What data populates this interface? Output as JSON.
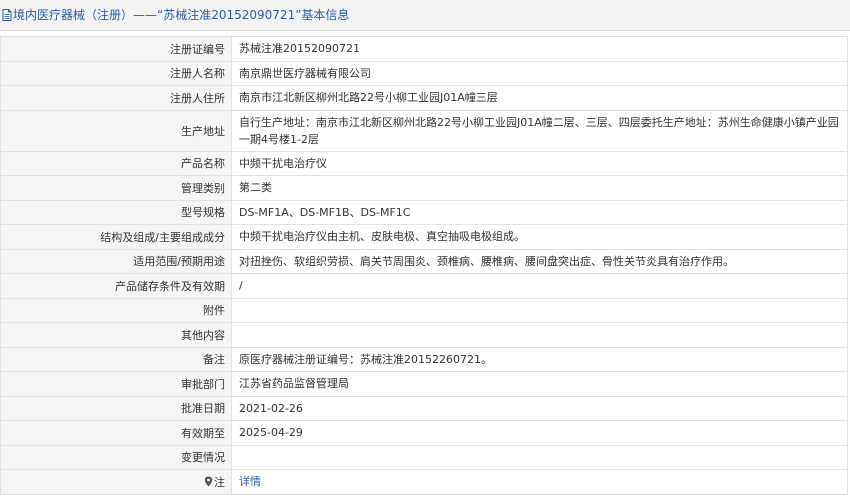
{
  "page_title": "境内医疗器械（注册）——“苏械注准20152090721”基本信息",
  "rows": [
    {
      "label": "注册证编号",
      "value": "苏械注准20152090721"
    },
    {
      "label": "注册人名称",
      "value": "南京鼎世医疗器械有限公司"
    },
    {
      "label": "注册人住所",
      "value": "南京市江北新区柳州北路22号小柳工业园J01A幢三层"
    },
    {
      "label": "生产地址",
      "value": "自行生产地址：南京市江北新区柳州北路22号小柳工业园J01A幢二层、三层、四层委托生产地址：苏州生命健康小镇产业园一期4号楼1-2层"
    },
    {
      "label": "产品名称",
      "value": "中频干扰电治疗仪"
    },
    {
      "label": "管理类别",
      "value": "第二类"
    },
    {
      "label": "型号规格",
      "value": "DS-MF1A、DS-MF1B、DS-MF1C"
    },
    {
      "label": "结构及组成/主要组成成分",
      "value": "中频干扰电治疗仪由主机、皮肤电极、真空抽吸电极组成。"
    },
    {
      "label": "适用范围/预期用途",
      "value": "对扭挫伤、软组织劳损、肩关节周围炎、颈椎病、腰椎病、腰间盘突出症、骨性关节炎具有治疗作用。"
    },
    {
      "label": "产品储存条件及有效期",
      "value": "/"
    },
    {
      "label": "附件",
      "value": ""
    },
    {
      "label": "其他内容",
      "value": ""
    },
    {
      "label": "备注",
      "value": "原医疗器械注册证编号：苏械注准20152260721。"
    },
    {
      "label": "审批部门",
      "value": "江苏省药品监督管理局"
    },
    {
      "label": "批准日期",
      "value": "2021-02-26"
    },
    {
      "label": "有效期至",
      "value": "2025-04-29"
    },
    {
      "label": "变更情况",
      "value": ""
    }
  ],
  "note_row": {
    "label": "注",
    "link_text": "详情",
    "icon": "pin-icon"
  },
  "colors": {
    "link": "#2a5ca8",
    "label_bg": "#f5f5f5",
    "border": "#e2e2e2",
    "header_bg": "#f3f3f3"
  }
}
